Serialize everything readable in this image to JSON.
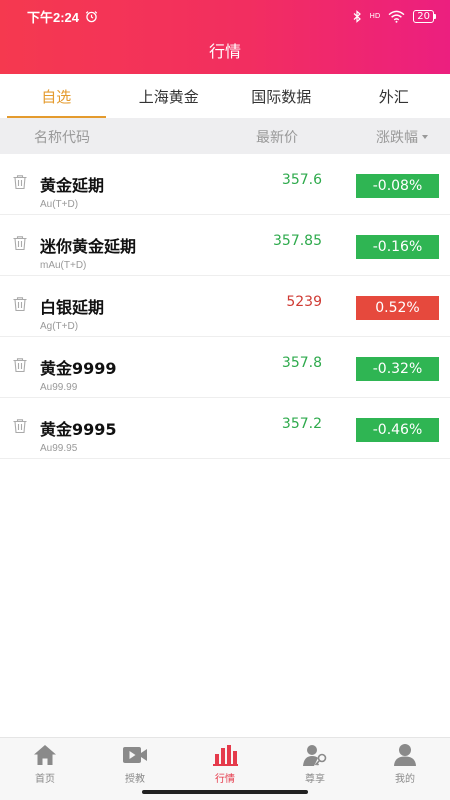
{
  "status": {
    "time": "下午2:24",
    "battery": "20",
    "network": "HD"
  },
  "header": {
    "title": "行情"
  },
  "tabs": [
    {
      "label": "自选",
      "active": true
    },
    {
      "label": "上海黄金",
      "active": false
    },
    {
      "label": "国际数据",
      "active": false
    },
    {
      "label": "外汇",
      "active": false
    }
  ],
  "columns": {
    "name": "名称代码",
    "price": "最新价",
    "change": "涨跌幅"
  },
  "items": [
    {
      "name": "黄金延期",
      "code": "Au(T+D)",
      "price": "357.6",
      "change": "-0.08%",
      "dir": "down"
    },
    {
      "name": "迷你黄金延期",
      "code": "mAu(T+D)",
      "price": "357.85",
      "change": "-0.16%",
      "dir": "down"
    },
    {
      "name": "白银延期",
      "code": "Ag(T+D)",
      "price": "5239",
      "change": "0.52%",
      "dir": "up"
    },
    {
      "name": "黄金9999",
      "code": "Au99.99",
      "price": "357.8",
      "change": "-0.32%",
      "dir": "down"
    },
    {
      "name": "黄金9995",
      "code": "Au99.95",
      "price": "357.2",
      "change": "-0.46%",
      "dir": "down"
    }
  ],
  "nav": [
    {
      "label": "首页",
      "icon": "home-icon"
    },
    {
      "label": "授教",
      "icon": "video-icon"
    },
    {
      "label": "行情",
      "icon": "chart-icon",
      "active": true
    },
    {
      "label": "尊享",
      "icon": "vip-icon"
    },
    {
      "label": "我的",
      "icon": "user-icon"
    }
  ],
  "colors": {
    "accent": "#e49b2e",
    "down": "#2fb553",
    "up": "#e6493d",
    "nav_active": "#e53a4b"
  }
}
